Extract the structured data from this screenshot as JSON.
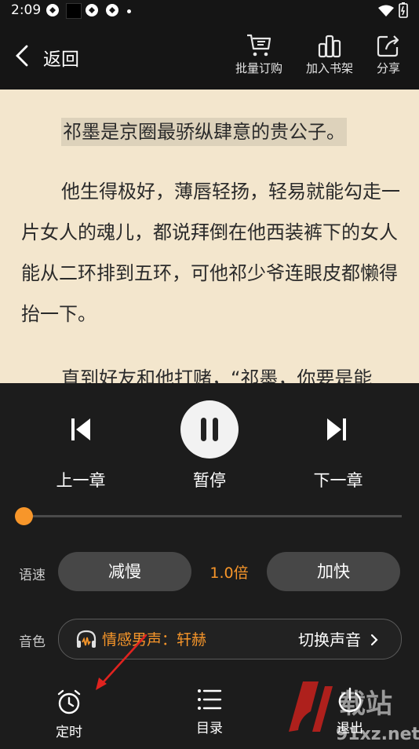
{
  "status_bar": {
    "time": "2:09"
  },
  "header": {
    "back_label": "返回",
    "actions": [
      {
        "label": "批量订购",
        "icon": "cart-icon"
      },
      {
        "label": "加入书架",
        "icon": "bookshelf-icon"
      },
      {
        "label": "分享",
        "icon": "share-icon"
      }
    ]
  },
  "reader": {
    "paragraphs": [
      "祁墨是京圈最骄纵肆意的贵公子。",
      "他生得极好，薄唇轻扬，轻易就能勾走一片女人的魂儿，都说拜倒在他西装裤下的女人能从二环排到五环，可他祁少爷连眼皮都懒得抬一下。",
      "直到好友和他打赌，“祁墨，你要是能"
    ]
  },
  "player": {
    "prev_label": "上一章",
    "pause_label": "暂停",
    "next_label": "下一章",
    "progress": 0.0,
    "speed_label": "语速",
    "slower_label": "减慢",
    "speed_value": "1.0倍",
    "faster_label": "加快",
    "voice_label": "音色",
    "voice_name": "情感男声：轩赫",
    "switch_voice_label": "切换声音",
    "accent_color": "#f7962a"
  },
  "bottom_bar": {
    "timer_label": "定时",
    "toc_label": "目录",
    "exit_label": "退出"
  },
  "watermark": {
    "text": "91xz.net",
    "big": "载站"
  }
}
